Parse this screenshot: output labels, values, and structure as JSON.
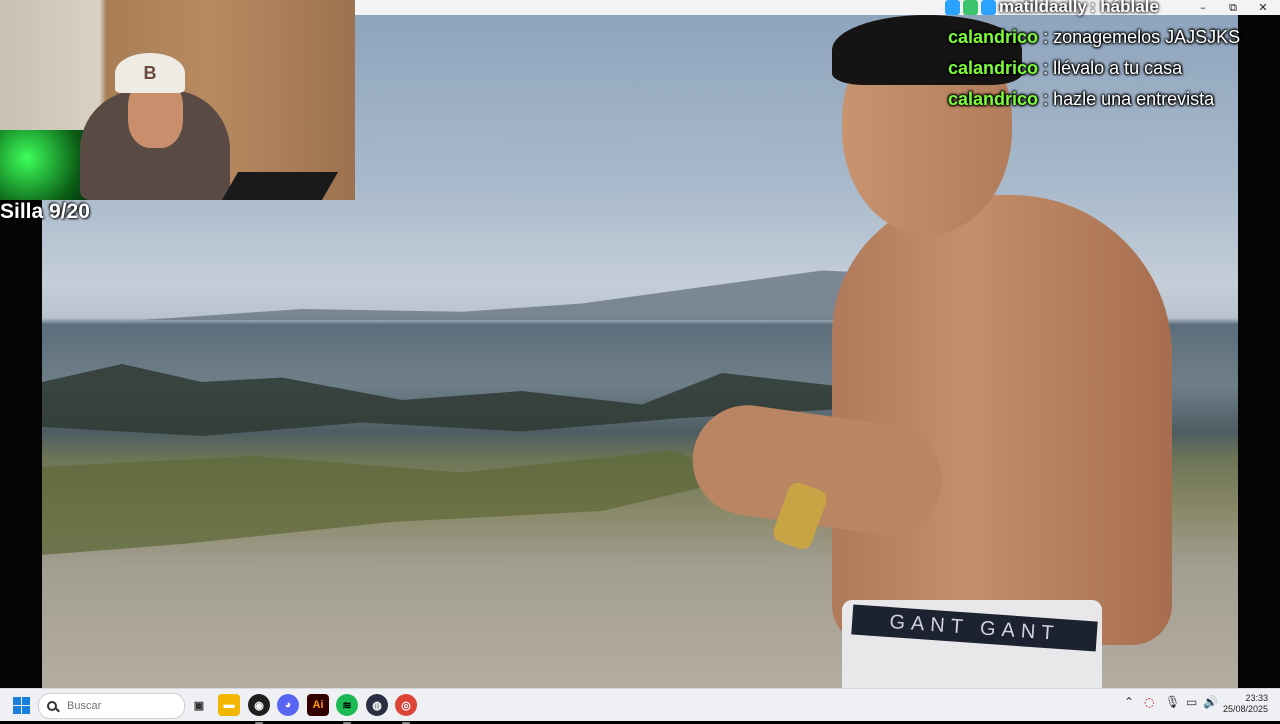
{
  "window": {
    "minimize": "–",
    "restore": "⧉",
    "close": "✕"
  },
  "overlay": {
    "counter": "Silla 9/20",
    "top_user": "matildaally",
    "top_message": ": háblale"
  },
  "chat": {
    "messages": [
      {
        "user": "calandrico",
        "text": ": zonagemelos JAJSJKS"
      },
      {
        "user": "calandrico",
        "text": ": llévalo a tu casa"
      },
      {
        "user": "calandrico",
        "text": ": hazle una entrevista"
      }
    ]
  },
  "video": {
    "waistband_text": "GANT GANT"
  },
  "webcam": {
    "cap_letter": "B"
  },
  "taskbar": {
    "search_placeholder": "Buscar",
    "apps": [
      {
        "name": "task-view",
        "glyph": "▣",
        "color": "#333333"
      },
      {
        "name": "file-explorer",
        "glyph": "▬",
        "color": "#f2b600"
      },
      {
        "name": "obs",
        "glyph": "◉",
        "color": "#1f1f1f"
      },
      {
        "name": "discord",
        "glyph": "◕",
        "color": "#5865f2"
      },
      {
        "name": "illustrator",
        "glyph": "Ai",
        "color": "#330000"
      },
      {
        "name": "spotify",
        "glyph": "≋",
        "color": "#1db954"
      },
      {
        "name": "app-dark",
        "glyph": "◍",
        "color": "#2b2d42"
      },
      {
        "name": "chrome",
        "glyph": "◎",
        "color": "#db4437"
      }
    ],
    "tray": {
      "chevron": "⌃",
      "location": "◌",
      "mic": "🎙",
      "network": "▭",
      "volume": "🔊"
    },
    "time": "23:33",
    "date": "25/08/2025"
  },
  "colors": {
    "chat_username": "#7cfc3a",
    "start_blue": "#1a7de0"
  }
}
